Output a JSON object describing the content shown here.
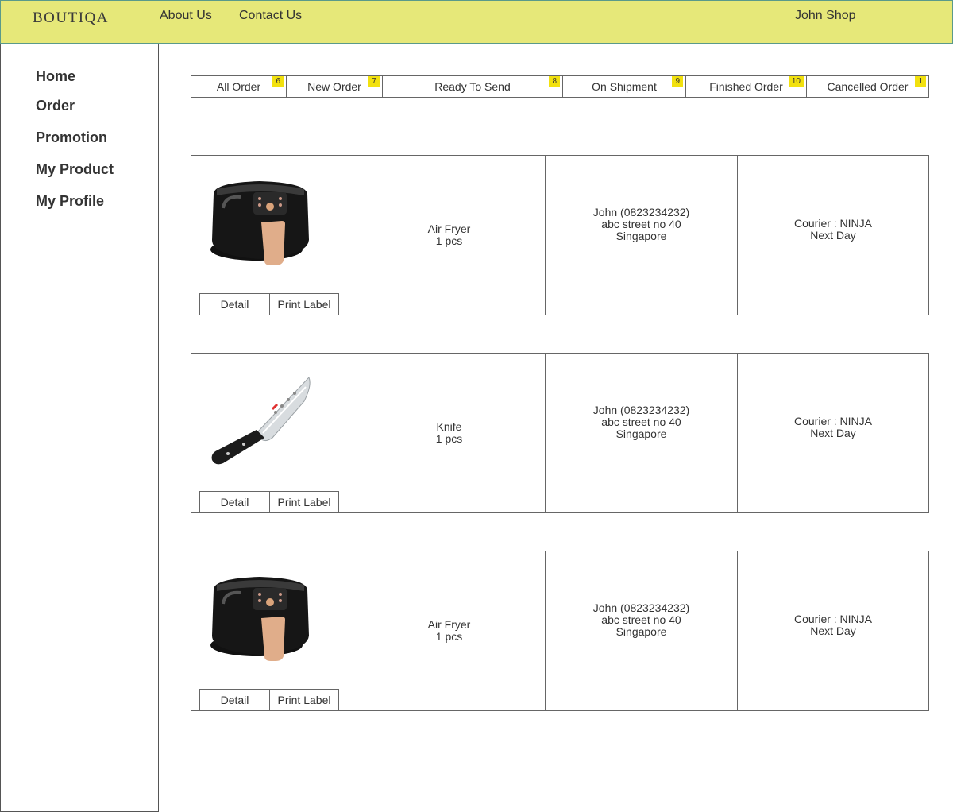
{
  "header": {
    "logo": "BOUTIQA",
    "nav": [
      "About Us",
      "Contact Us"
    ],
    "shop_name": "John Shop",
    "bg_color": "#e6e879"
  },
  "sidebar": {
    "items": [
      "Home",
      "Order",
      "Promotion",
      "My Product",
      "My Profile"
    ]
  },
  "tabs": [
    {
      "label": "All Order",
      "count": "6"
    },
    {
      "label": "New Order",
      "count": "7"
    },
    {
      "label": "Ready To Send",
      "count": "8"
    },
    {
      "label": "On Shipment",
      "count": "9"
    },
    {
      "label": "Finished Order",
      "count": "10"
    },
    {
      "label": "Cancelled Order",
      "count": "1"
    }
  ],
  "badge_color": "#f2e10e",
  "orders": [
    {
      "image_icon": "air-fryer-image",
      "product_name": "Air Fryer",
      "quantity": "1 pcs",
      "customer": "John (0823234232)",
      "street": "abc street no 40",
      "city": "Singapore",
      "courier": "Courier : NINJA",
      "service": "Next Day",
      "detail_label": "Detail",
      "print_label": "Print Label"
    },
    {
      "image_icon": "knife-image",
      "product_name": "Knife",
      "quantity": "1 pcs",
      "customer": "John (0823234232)",
      "street": "abc street no 40",
      "city": "Singapore",
      "courier": "Courier : NINJA",
      "service": "Next Day",
      "detail_label": "Detail",
      "print_label": "Print Label"
    },
    {
      "image_icon": "air-fryer-image",
      "product_name": "Air Fryer",
      "quantity": "1 pcs",
      "customer": "John (0823234232)",
      "street": "abc street no 40",
      "city": "Singapore",
      "courier": "Courier : NINJA",
      "service": "Next Day",
      "detail_label": "Detail",
      "print_label": "Print Label"
    }
  ]
}
